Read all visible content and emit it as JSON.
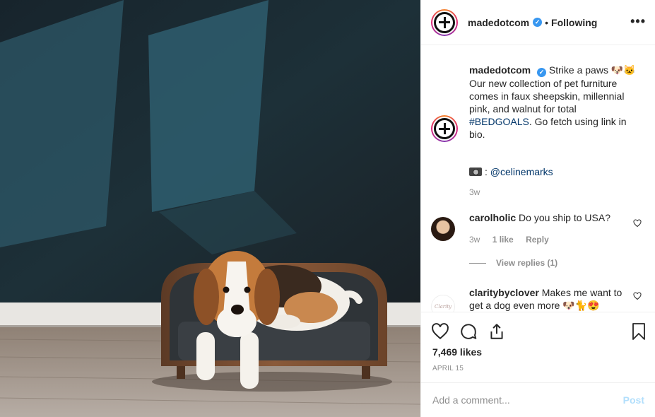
{
  "post": {
    "username": "madedotcom",
    "separator": "•",
    "follow_status": "Following",
    "more_label": "•••",
    "verified_glyph": "✓"
  },
  "caption": {
    "username": "madedotcom",
    "line1": "Strike a paws 🐶🐱",
    "body": "Our new collection of pet furniture comes in faux sheepskin, millennial pink, and walnut for total ",
    "hashtag": "#BEDGOALS",
    "body_end": ". Go fetch using link in bio.",
    "credit_prefix": ":",
    "credit_mention": "@celinemarks",
    "time": "3w"
  },
  "comments": [
    {
      "username": "carolholic",
      "text": "Do you ship to USA?",
      "time": "3w",
      "likes": "1 like",
      "reply_label": "Reply",
      "view_replies": "View replies (1)"
    },
    {
      "username": "claritybyclover",
      "text": "Makes me want to get a dog even more 🐶🐈😍",
      "avatar_text": "Clarity"
    }
  ],
  "actions": {
    "icons": [
      "heart-icon",
      "comment-icon",
      "share-icon",
      "bookmark-icon"
    ],
    "likes": "7,469 likes",
    "date": "APRIL 15"
  },
  "composer": {
    "placeholder": "Add a comment...",
    "post_label": "Post"
  },
  "colors": {
    "link": "#003569",
    "verified": "#3897f0",
    "muted": "#8e8e8e",
    "post_disabled": "#b2dffc"
  }
}
